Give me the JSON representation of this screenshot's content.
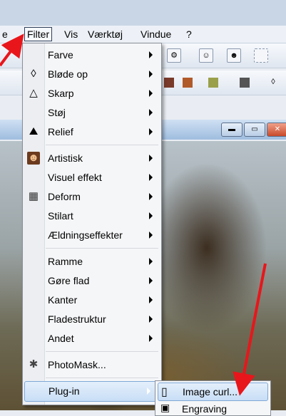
{
  "menubar": {
    "items": [
      {
        "label": "e"
      },
      {
        "label": "Filter",
        "active": true
      },
      {
        "label": "Vis"
      },
      {
        "label": "Værktøj"
      },
      {
        "label": "Vindue"
      },
      {
        "label": "?"
      }
    ]
  },
  "filter_menu": {
    "items": [
      {
        "label": "Farve",
        "icon": "none",
        "submenu": true
      },
      {
        "label": "Bløde op",
        "icon": "droplet-icon",
        "submenu": true
      },
      {
        "label": "Skarp",
        "icon": "triangle-icon",
        "submenu": true
      },
      {
        "label": "Støj",
        "icon": "none",
        "submenu": true
      },
      {
        "label": "Relief",
        "icon": "relief-icon",
        "submenu": true
      },
      {
        "label": "Artistisk",
        "icon": "portrait-icon",
        "submenu": true
      },
      {
        "label": "Visuel effekt",
        "icon": "none",
        "submenu": true
      },
      {
        "label": "Deform",
        "icon": "grid-icon",
        "submenu": true
      },
      {
        "label": "Stilart",
        "icon": "none",
        "submenu": true
      },
      {
        "label": "Ældningseffekter",
        "icon": "none",
        "submenu": true
      },
      {
        "label": "Ramme",
        "icon": "none",
        "submenu": true
      },
      {
        "label": "Gøre flad",
        "icon": "none",
        "submenu": true
      },
      {
        "label": "Kanter",
        "icon": "none",
        "submenu": true
      },
      {
        "label": "Fladestruktur",
        "icon": "none",
        "submenu": true
      },
      {
        "label": "Andet",
        "icon": "none",
        "submenu": true
      },
      {
        "label": "PhotoMask...",
        "icon": "photomask-icon",
        "submenu": false
      },
      {
        "label": "Plug-in",
        "icon": "none",
        "submenu": true,
        "highlighted": true
      }
    ]
  },
  "plugin_submenu": {
    "items": [
      {
        "label": "Image curl...",
        "icon": "page-curl-icon",
        "highlighted": true
      },
      {
        "label": "Engraving",
        "icon": "engraving-icon"
      }
    ]
  },
  "colors": {
    "annotation_arrow": "#e8161b",
    "highlight": "#c8def6",
    "menu_background": "#f5f6f8"
  }
}
